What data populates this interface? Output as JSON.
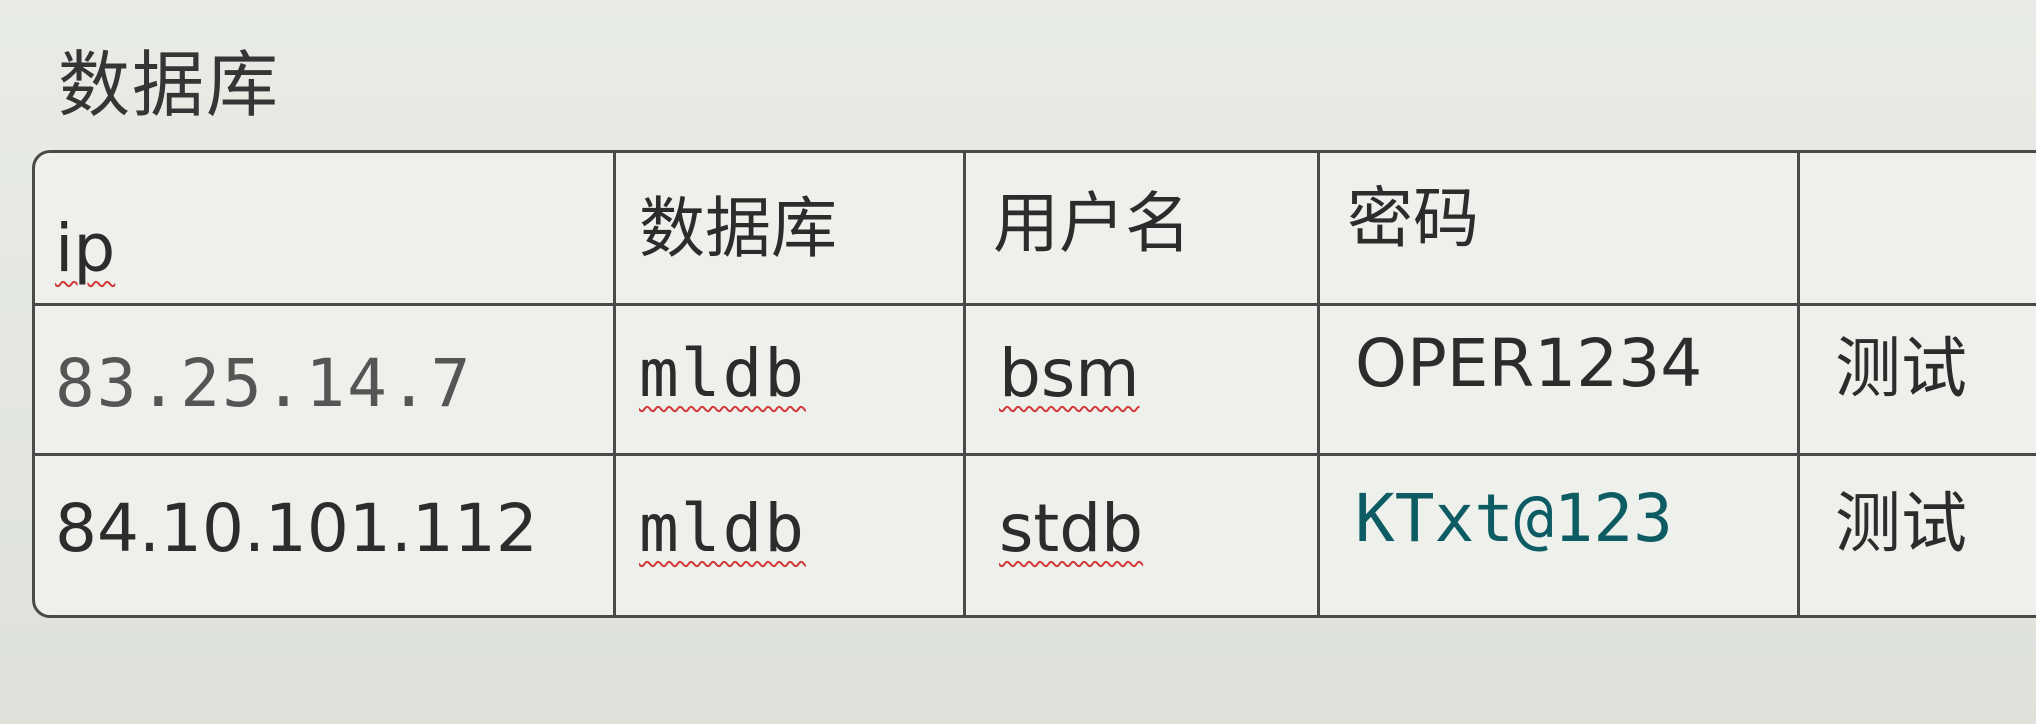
{
  "heading": "数据库",
  "table": {
    "headers": [
      "ip",
      "数据库",
      "用户名",
      "密码",
      ""
    ],
    "rows": [
      [
        "83.25.14.7",
        "mldb",
        "bsm",
        "OPER1234",
        "测试"
      ],
      [
        "84.10.101.112",
        "mldb",
        "stdb",
        "KTxt@123",
        "测试"
      ]
    ]
  }
}
